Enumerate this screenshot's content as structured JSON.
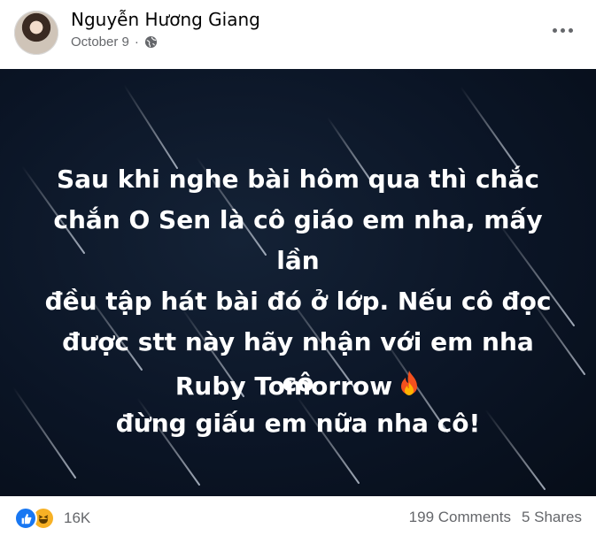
{
  "post": {
    "author": "Nguyễn Hương Giang",
    "date": "October 9",
    "date_separator": "·",
    "privacy_icon": "globe-icon",
    "more_icon": "more-options-icon"
  },
  "content": {
    "lines": [
      "Sau khi nghe bài hôm qua thì chắc",
      "chắn O Sen là cô giáo em nha, mấy lần",
      "đều tập hát bài đó ở lớp. Nếu cô đọc",
      "được stt này hãy nhận với em nha cô",
      "đừng giấu em nữa nha cô!"
    ],
    "signature": "Ruby Tomorrow",
    "signature_emoji": "fire-icon",
    "text_color": "#ffffff",
    "background_color": "#0b1526"
  },
  "footer": {
    "reaction_icons": [
      "like-icon",
      "haha-icon"
    ],
    "reaction_count": "16K",
    "comments": "199 Comments",
    "shares": "5 Shares"
  },
  "colors": {
    "secondary_text": "#65676b",
    "like_blue": "#1877f2",
    "haha_yellow": "#f7b125"
  }
}
